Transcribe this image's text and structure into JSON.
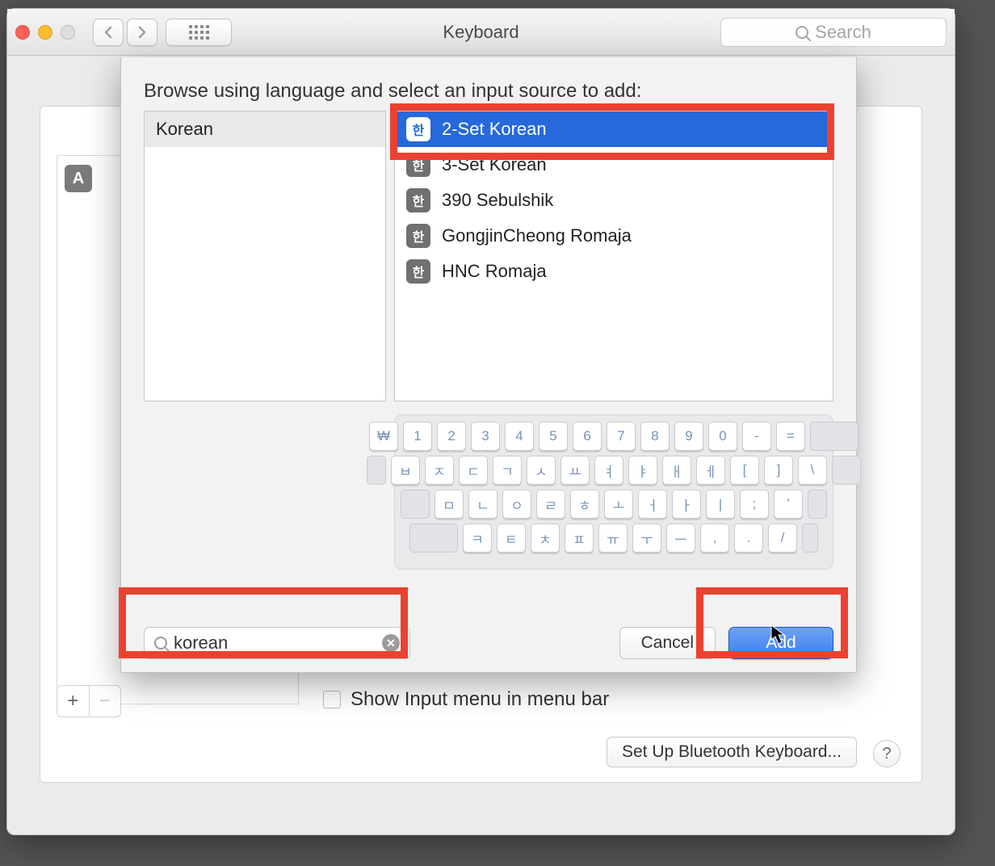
{
  "titlebar": {
    "title": "Keyboard",
    "search_placeholder": "Search"
  },
  "background": {
    "item_letter": "A",
    "show_input_label": "Show Input menu in menu bar",
    "setup_bt_label": "Set Up Bluetooth Keyboard...",
    "plus": "+",
    "minus": "−"
  },
  "sheet": {
    "prompt": "Browse using language and select an input source to add:",
    "language_list": [
      "Korean"
    ],
    "sources": [
      {
        "icon": "한",
        "label": "2-Set Korean",
        "selected": true
      },
      {
        "icon": "한",
        "label": "3-Set Korean",
        "selected": false
      },
      {
        "icon": "한",
        "label": "390 Sebulshik",
        "selected": false
      },
      {
        "icon": "한",
        "label": "GongjinCheong Romaja",
        "selected": false
      },
      {
        "icon": "한",
        "label": "HNC Romaja",
        "selected": false
      }
    ],
    "keyboard_rows": [
      [
        "₩",
        "1",
        "2",
        "3",
        "4",
        "5",
        "6",
        "7",
        "8",
        "9",
        "0",
        "-",
        "="
      ],
      [
        "ㅂ",
        "ㅈ",
        "ㄷ",
        "ㄱ",
        "ㅅ",
        "ㅛ",
        "ㅕ",
        "ㅑ",
        "ㅐ",
        "ㅔ",
        "[",
        "]",
        "\\"
      ],
      [
        "ㅁ",
        "ㄴ",
        "ㅇ",
        "ㄹ",
        "ㅎ",
        "ㅗ",
        "ㅓ",
        "ㅏ",
        "ㅣ",
        ";",
        "'"
      ],
      [
        "ㅋ",
        "ㅌ",
        "ㅊ",
        "ㅍ",
        "ㅠ",
        "ㅜ",
        "ㅡ",
        ",",
        ".",
        "/"
      ]
    ],
    "search_value": "korean",
    "cancel_label": "Cancel",
    "add_label": "Add"
  }
}
